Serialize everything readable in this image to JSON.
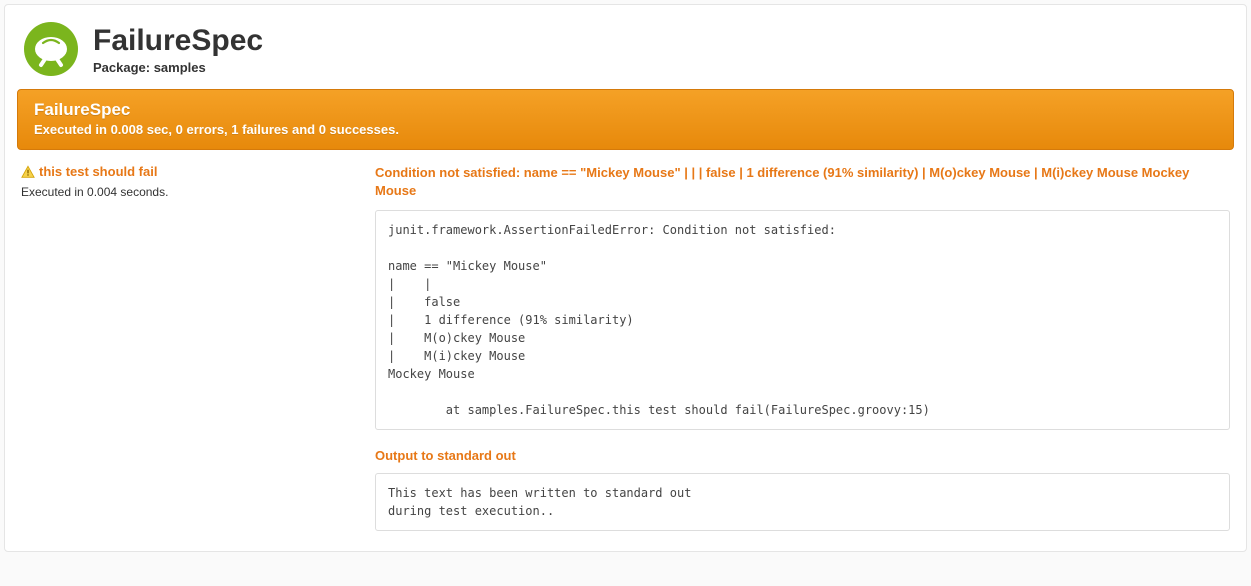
{
  "header": {
    "title": "FailureSpec",
    "package_label": "Package: samples"
  },
  "banner": {
    "spec_name": "FailureSpec",
    "summary": "Executed in 0.008 sec, 0 errors, 1 failures and 0 successes."
  },
  "test": {
    "name": "this test should fail",
    "exec_time": "Executed in 0.004 seconds."
  },
  "failure": {
    "message": "Condition not satisfied: name == \"Mickey Mouse\" | | | false | 1 difference (91% similarity) | M(o)ckey Mouse | M(i)ckey Mouse Mockey Mouse",
    "stack": "junit.framework.AssertionFailedError: Condition not satisfied:\n\nname == \"Mickey Mouse\"\n|    |\n|    false\n|    1 difference (91% similarity)\n|    M(o)ckey Mouse\n|    M(i)ckey Mouse\nMockey Mouse\n\n        at samples.FailureSpec.this test should fail(FailureSpec.groovy:15)"
  },
  "stdout": {
    "heading": "Output to standard out",
    "body": "This text has been written to standard out\nduring test execution.."
  }
}
